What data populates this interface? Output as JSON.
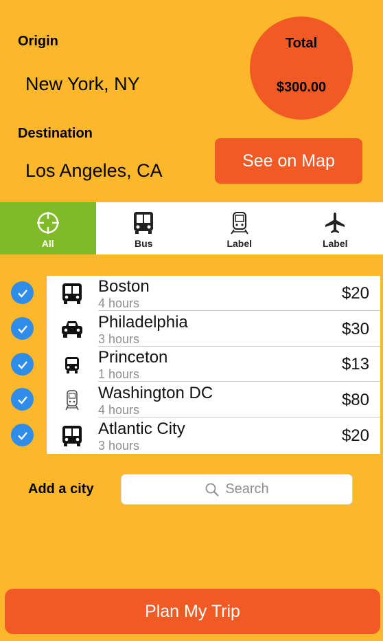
{
  "origin": {
    "label": "Origin",
    "value": "New York, NY"
  },
  "destination": {
    "label": "Destination",
    "value": "Los Angeles, CA"
  },
  "total": {
    "label": "Total",
    "value": "$300.00"
  },
  "map_button": "See on Map",
  "tabs": [
    {
      "label": "All",
      "icon": "crosshair-icon",
      "active": true
    },
    {
      "label": "Bus",
      "icon": "bus-icon",
      "active": false
    },
    {
      "label": "Label",
      "icon": "train-icon",
      "active": false
    },
    {
      "label": "Label",
      "icon": "plane-icon",
      "active": false
    }
  ],
  "trips": [
    {
      "city": "Boston",
      "duration": "4 hours",
      "price": "$20",
      "icon": "bus-icon",
      "checked": true
    },
    {
      "city": "Philadelphia",
      "duration": "3 hours",
      "price": "$30",
      "icon": "car-icon",
      "checked": true
    },
    {
      "city": "Princeton",
      "duration": "1 hours",
      "price": "$13",
      "icon": "bus-front-icon",
      "checked": true
    },
    {
      "city": "Washington DC",
      "duration": "4 hours",
      "price": "$80",
      "icon": "train-icon",
      "checked": true
    },
    {
      "city": "Atlantic City",
      "duration": "3 hours",
      "price": "$20",
      "icon": "bus-icon",
      "checked": true
    }
  ],
  "add_city": {
    "label": "Add a city",
    "placeholder": "Search"
  },
  "plan_button": "Plan My Trip",
  "colors": {
    "background": "#fcb72a",
    "accent": "#f15a24",
    "active_tab": "#7fba28",
    "check": "#2f8ce8"
  }
}
